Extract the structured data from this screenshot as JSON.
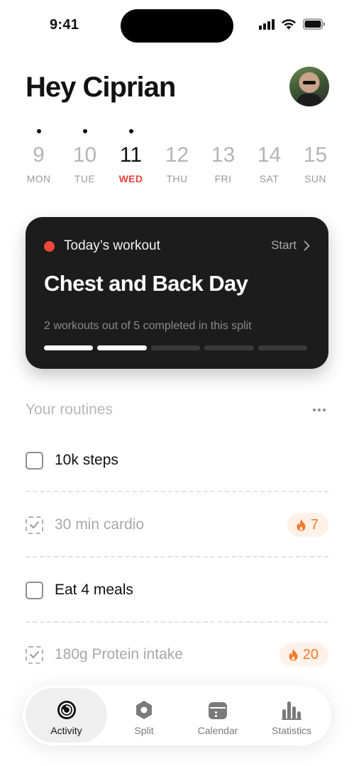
{
  "status_bar": {
    "time": "9:41"
  },
  "header": {
    "greeting": "Hey Ciprian"
  },
  "week": [
    {
      "number": "9",
      "label": "MON",
      "has_dot": true,
      "active": false
    },
    {
      "number": "10",
      "label": "TUE",
      "has_dot": true,
      "active": false
    },
    {
      "number": "11",
      "label": "WED",
      "has_dot": true,
      "active": true
    },
    {
      "number": "12",
      "label": "THU",
      "has_dot": false,
      "active": false
    },
    {
      "number": "13",
      "label": "FRI",
      "has_dot": false,
      "active": false
    },
    {
      "number": "14",
      "label": "SAT",
      "has_dot": false,
      "active": false
    },
    {
      "number": "15",
      "label": "SUN",
      "has_dot": false,
      "active": false
    }
  ],
  "workout_card": {
    "label": "Today’s workout",
    "start_label": "Start",
    "title": "Chest and Back Day",
    "progress_text": "2 workouts out of 5 completed in this split",
    "completed": 2,
    "total": 5
  },
  "routines": {
    "title": "Your routines",
    "items": [
      {
        "label": "10k steps",
        "done": false,
        "streak": null
      },
      {
        "label": "30 min cardio",
        "done": true,
        "streak": "7"
      },
      {
        "label": "Eat 4 meals",
        "done": false,
        "streak": null
      },
      {
        "label": "180g Protein intake",
        "done": true,
        "streak": "20"
      }
    ]
  },
  "tab_bar": {
    "items": [
      {
        "label": "Activity",
        "icon": "activity-icon",
        "active": true
      },
      {
        "label": "Split",
        "icon": "split-icon",
        "active": false
      },
      {
        "label": "Calendar",
        "icon": "calendar-icon",
        "active": false
      },
      {
        "label": "Statistics",
        "icon": "statistics-icon",
        "active": false
      }
    ]
  },
  "colors": {
    "accent_red": "#e5453a",
    "streak_orange": "#f07a2a",
    "card_background": "#1c1c1c"
  }
}
